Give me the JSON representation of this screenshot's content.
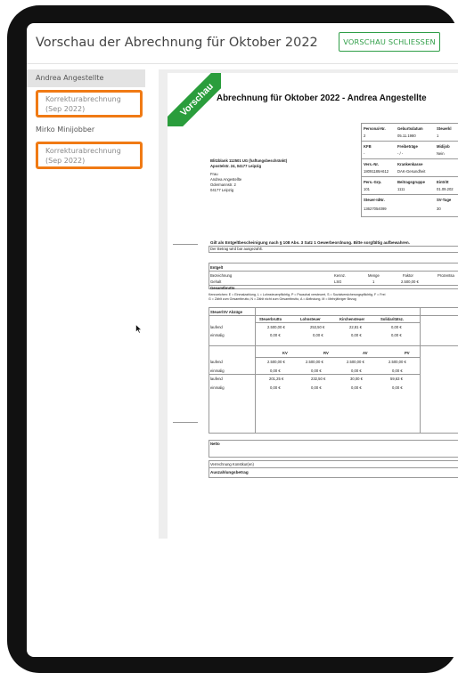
{
  "modal": {
    "title": "Vorschau der Abrechnung für Oktober 2022",
    "close_label": "VORSCHAU SCHLIESSEN"
  },
  "sidebar": {
    "people": [
      {
        "name": "Andrea Angestellte",
        "item_line1": "Korrekturabrechnung",
        "item_line2": "(Sep 2022)"
      },
      {
        "name": "Mirko Minijobber",
        "item_line1": "Korrekturabrechnung",
        "item_line2": "(Sep 2022)"
      }
    ]
  },
  "document": {
    "ribbon": "Vorschau",
    "title": "Abrechnung für Oktober 2022 - Andrea Angestellte",
    "employer": {
      "name": "Blitzblank 112501 UG (haftungsbeschränkt)",
      "address": "Apostelstr. 24, 04177 Leipzig"
    },
    "recipient": [
      "Frau",
      "Andrea Angestellte",
      "Odermannstr. 2",
      "04177 Leipzig"
    ],
    "info": {
      "r1_labels": [
        "Personal-Nr.",
        "Geburtsdatum",
        "Steuerkl"
      ],
      "r1_values": [
        "2",
        "05.11.1980",
        "1"
      ],
      "r2_labels": [
        "KFB",
        "Freibeträge",
        "Midijob"
      ],
      "r2_values": [
        "-",
        "- / -",
        "Nein"
      ],
      "r3_labels": [
        "Vers.-Nr.",
        "Krankenkasse"
      ],
      "r3_values": [
        "18091189A612",
        "DAK-Gesundheit"
      ],
      "r4_labels": [
        "Pers.-Grp.",
        "Beitragsgruppe",
        "Eintritt"
      ],
      "r4_values": [
        "101",
        "1111",
        "01.09.202"
      ],
      "r5_labels": [
        "Steuer-IdNr.",
        "SV-Tage"
      ],
      "r5_values": [
        "13627054099",
        "30"
      ]
    },
    "notice_bold": "Gilt als Entgeltbescheinigung nach § 108 Abs. 3 Satz 1 Gewerbeordnung. Bitte sorgfältig aufbewahren.",
    "notice_sub": "Der Betrag wird bar ausgezahlt.",
    "entgelt": {
      "heading": "Entgelt",
      "cols": [
        "Bezeichnung",
        "Kennz.",
        "Menge",
        "Faktor",
        "Prozentsa"
      ],
      "row": [
        "Gehalt",
        "LSG",
        "1",
        "2.500,00 €"
      ],
      "total_label": "Gesamtbrutto"
    },
    "kennz_note_1": "Kennzeichen: E = Einmalzahlung, L = Lohnsteuerpflichtig, P = Pauschal versteuert, S = Sozialversicherungspflichtig, F = Frei",
    "kennz_note_2": "G = Zählt zum Gesamtbrutto, N = Zählt nicht zum Gesamtbrutto, A = Abfindung, M = Mehrjähriger Bezug",
    "steuer": {
      "heading": "Steuer/SV Abzüge",
      "cols": [
        "Steuerbrutto",
        "Lohnsteuer",
        "Kirchensteuer",
        "Solidaritätsz."
      ],
      "rows": [
        {
          "label": "laufend",
          "values": [
            "2.500,00 €",
            "253,50 €",
            "22,81 €",
            "0,00 €"
          ]
        },
        {
          "label": "einmalig",
          "values": [
            "0,00 €",
            "0,00 €",
            "0,00 €",
            "0,00 €"
          ]
        }
      ]
    },
    "sv": {
      "cols": [
        "KV",
        "RV",
        "AV",
        "PV"
      ],
      "rows": [
        {
          "label": "laufend",
          "values": [
            "2.500,00 €",
            "2.500,00 €",
            "2.500,00 €",
            "2.500,00 €"
          ]
        },
        {
          "label": "einmalig",
          "values": [
            "0,00 €",
            "0,00 €",
            "0,00 €",
            "0,00 €"
          ]
        },
        {
          "label": "laufend",
          "values": [
            "201,25 €",
            "232,50 €",
            "30,00 €",
            "59,63 €"
          ]
        },
        {
          "label": "einmalig",
          "values": [
            "0,00 €",
            "0,00 €",
            "0,00 €",
            "0,00 €"
          ]
        }
      ]
    },
    "netto_label": "Netto",
    "verrechnung_label": "Verrechnung Konstkur(en)",
    "auszahlung_label": "Auszahlungsbetrag"
  },
  "colors": {
    "accent_green": "#2f9e47",
    "highlight_orange": "#f07a14",
    "ribbon_green": "#2a9d3c"
  }
}
